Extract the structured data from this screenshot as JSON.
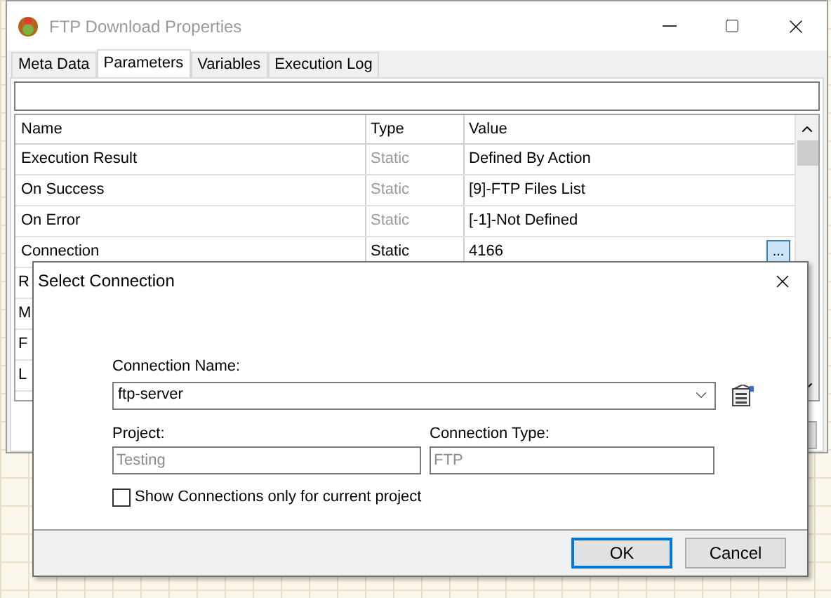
{
  "window": {
    "title": "FTP Download Properties"
  },
  "tabs": [
    {
      "label": "Meta Data",
      "selected": false
    },
    {
      "label": "Parameters",
      "selected": true
    },
    {
      "label": "Variables",
      "selected": false
    },
    {
      "label": "Execution Log",
      "selected": false
    }
  ],
  "table": {
    "columns": [
      "Name",
      "Type",
      "Value"
    ],
    "rows": [
      {
        "name": "Execution Result",
        "type": "Static",
        "value": "Defined By Action",
        "disabled": true
      },
      {
        "name": "On Success",
        "type": "Static",
        "value": "[9]-FTP Files List",
        "disabled": true
      },
      {
        "name": "On Error",
        "type": "Static",
        "value": "[-1]-Not Defined",
        "disabled": true
      },
      {
        "name": "Connection",
        "type": "Static",
        "value": "4166",
        "disabled": false,
        "button": "..."
      }
    ],
    "obscured_rows": [
      "R",
      "M",
      "F",
      "L"
    ]
  },
  "dialog": {
    "title": "Select Connection",
    "connection_name_label": "Connection Name:",
    "connection_name": "ftp-server",
    "project_label": "Project:",
    "project": "Testing",
    "connection_type_label": "Connection Type:",
    "connection_type": "FTP",
    "checkbox": {
      "label": "Show Connections only for current project",
      "checked": false
    },
    "buttons": [
      {
        "label": "OK",
        "selected": true
      },
      {
        "label": "Cancel",
        "selected": false
      }
    ]
  }
}
